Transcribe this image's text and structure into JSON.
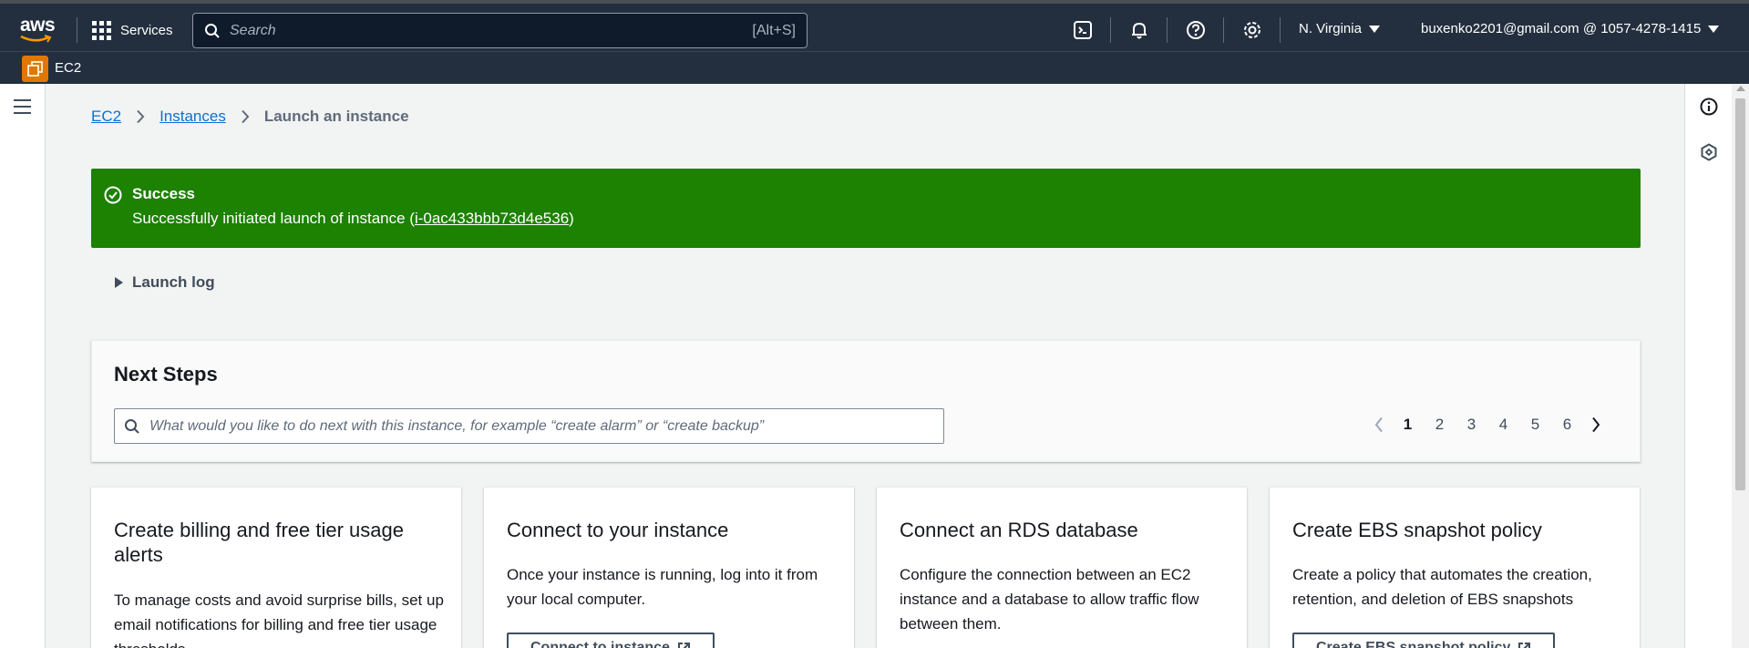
{
  "topnav": {
    "logo": "aws",
    "services_label": "Services",
    "search_placeholder": "Search",
    "search_shortcut": "[Alt+S]",
    "region": "N. Virginia",
    "account": "buxenko2201@gmail.com @ 1057-4278-1415"
  },
  "subnav": {
    "service": "EC2"
  },
  "breadcrumb": {
    "root": "EC2",
    "parent": "Instances",
    "current": "Launch an instance"
  },
  "flash": {
    "title": "Success",
    "message_prefix": "Successfully initiated launch of instance (",
    "instance_id": "i-0ac433bbb73d4e536",
    "message_suffix": ")"
  },
  "launch_log": {
    "label": "Launch log"
  },
  "next_steps": {
    "title": "Next Steps",
    "search_placeholder": "What would you like to do next with this instance, for example “create alarm” or “create backup”",
    "pages": [
      "1",
      "2",
      "3",
      "4",
      "5",
      "6"
    ],
    "current_page": "1"
  },
  "cards": [
    {
      "title": "Create billing and free tier usage alerts",
      "description": "To manage costs and avoid surprise bills, set up email notifications for billing and free tier usage thresholds."
    },
    {
      "title": "Connect to your instance",
      "description": "Once your instance is running, log into it from your local computer.",
      "button": "Connect to instance"
    },
    {
      "title": "Connect an RDS database",
      "description": "Configure the connection between an EC2 instance and a database to allow traffic flow between them."
    },
    {
      "title": "Create EBS snapshot policy",
      "description": "Create a policy that automates the creation, retention, and deletion of EBS snapshots",
      "button": "Create EBS snapshot policy"
    }
  ],
  "colors": {
    "nav_bg": "#232f3e",
    "success_bg": "#1d8102",
    "link": "#0972d3",
    "ec2_badge": "#e07700"
  }
}
